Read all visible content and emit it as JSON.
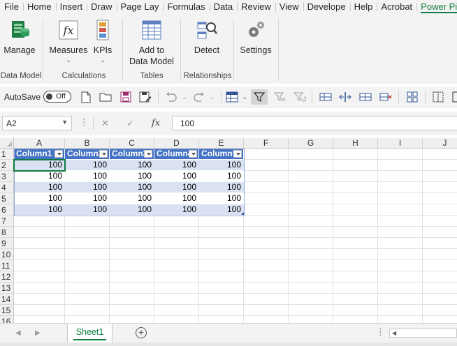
{
  "ribbon_tabs": [
    "File",
    "Home",
    "Insert",
    "Draw",
    "Page Lay",
    "Formulas",
    "Data",
    "Review",
    "View",
    "Develope",
    "Help",
    "Acrobat",
    "Power Pi"
  ],
  "active_tab": "Power Pi",
  "ribbon": {
    "manage": "Manage",
    "measures": "Measures",
    "kpis": "KPIs",
    "add_to_data_model_1": "Add to",
    "add_to_data_model_2": "Data Model",
    "detect": "Detect",
    "settings": "Settings",
    "groups": {
      "data_model": "Data Model",
      "calculations": "Calculations",
      "tables": "Tables",
      "relationships": "Relationships"
    }
  },
  "qat": {
    "autosave_label": "AutoSave",
    "autosave_state": "Off"
  },
  "formula_bar": {
    "name_box": "A2",
    "fx": "fx",
    "value": "100"
  },
  "columns": [
    "A",
    "B",
    "C",
    "D",
    "E",
    "F",
    "G",
    "H",
    "I",
    "J"
  ],
  "rows": [
    "1",
    "2",
    "3",
    "4",
    "5",
    "6",
    "7",
    "8",
    "9",
    "10",
    "11",
    "12",
    "13",
    "14",
    "15",
    "16"
  ],
  "table": {
    "headers": [
      "Column1",
      "Column2",
      "Column3",
      "Column4",
      "Column5"
    ],
    "body": [
      [
        "100",
        "100",
        "100",
        "100",
        "100"
      ],
      [
        "100",
        "100",
        "100",
        "100",
        "100"
      ],
      [
        "100",
        "100",
        "100",
        "100",
        "100"
      ],
      [
        "100",
        "100",
        "100",
        "100",
        "100"
      ],
      [
        "100",
        "100",
        "100",
        "100",
        "100"
      ]
    ]
  },
  "sheets": [
    "Sheet1"
  ],
  "colors": {
    "accent": "#107c41",
    "table_header": "#4472c4",
    "table_band": "#d9e1f2"
  }
}
